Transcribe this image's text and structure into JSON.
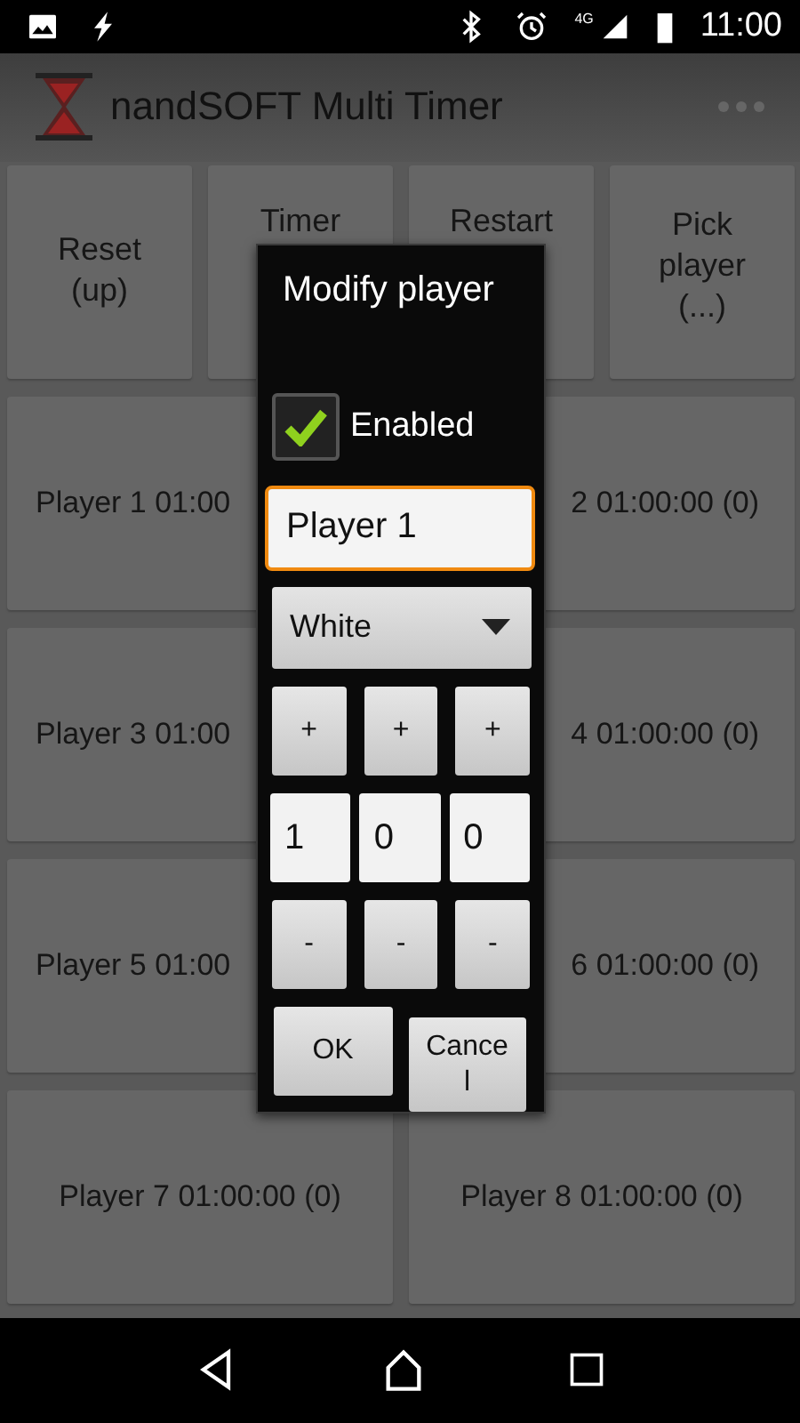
{
  "status_bar": {
    "time": "11:00",
    "network": "4G"
  },
  "app_bar": {
    "title": "nandSOFT Multi Timer"
  },
  "top_buttons": [
    {
      "lines": [
        "Reset",
        "(up)"
      ]
    },
    {
      "lines": [
        "Timer"
      ]
    },
    {
      "lines": [
        "Restart"
      ]
    },
    {
      "lines": [
        "Pick",
        "player",
        "(...)"
      ]
    }
  ],
  "players": [
    {
      "label": "Player 1 01:00",
      "kind": "cut_right"
    },
    {
      "label": "2 01:00:00 (0)",
      "kind": "cut_left"
    },
    {
      "label": "Player 3 01:00",
      "kind": "cut_right"
    },
    {
      "label": "4 01:00:00 (0)",
      "kind": "cut_left"
    },
    {
      "label": "Player 5 01:00",
      "kind": "cut_right"
    },
    {
      "label": "6 01:00:00 (0)",
      "kind": "cut_left"
    },
    {
      "label": "Player 7 01:00:00 (0)",
      "kind": "full"
    },
    {
      "label": "Player 8 01:00:00 (0)",
      "kind": "full"
    }
  ],
  "dialog": {
    "title": "Modify player",
    "enabled": {
      "label": "Enabled",
      "checked": true
    },
    "name": {
      "value": "Player 1",
      "focused": true
    },
    "color": {
      "value": "White"
    },
    "plus": [
      "+",
      "+",
      "+"
    ],
    "digits": [
      "1",
      "0",
      "0"
    ],
    "minus": [
      "-",
      "-",
      "-"
    ],
    "ok": "OK",
    "cancel": "Cancel"
  }
}
